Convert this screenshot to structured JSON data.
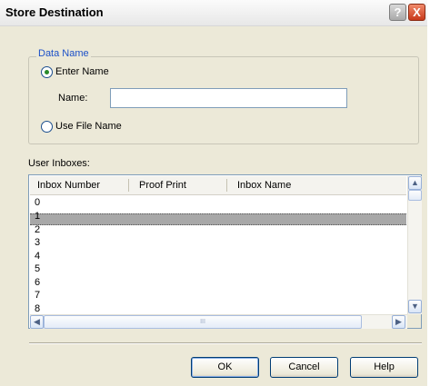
{
  "window": {
    "title": "Store Destination"
  },
  "titlebar": {
    "help_glyph": "?",
    "close_glyph": "X"
  },
  "data_name": {
    "legend": "Data Name",
    "enter_name_label": "Enter Name",
    "enter_name_selected": true,
    "name_label": "Name:",
    "name_value": "",
    "use_file_name_label": "Use File Name",
    "use_file_name_selected": false
  },
  "inboxes": {
    "label": "User Inboxes:",
    "columns": [
      "Inbox Number",
      "Proof Print",
      "Inbox Name"
    ],
    "rows": [
      "0",
      "1",
      "2",
      "3",
      "4",
      "5",
      "6",
      "7",
      "8"
    ],
    "selected_index": 1,
    "hscroll_grip": "III"
  },
  "buttons": {
    "ok": "OK",
    "cancel": "Cancel",
    "help": "Help"
  }
}
